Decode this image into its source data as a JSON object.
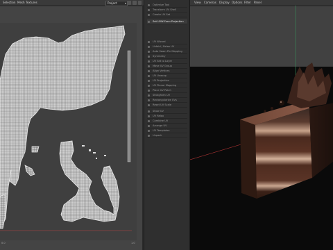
{
  "top_menu": [
    "Selection",
    "Mesh",
    "Textures"
  ],
  "uv_header": {
    "dropdown_value": "Project"
  },
  "uv_footer": {
    "left_value": "0.0",
    "right_value": "1.0"
  },
  "colors": {
    "wire": "#e2e2e2",
    "accent": "#2f6fb3",
    "green_axis": "#3a8f5a",
    "red_axis": "#a33"
  },
  "tools": {
    "items": [
      "Optimize Tool",
      "Transform UV Shell",
      "Create UV Set",
      "Set UVW From Projection",
      "UV Wizard",
      "Unfold / Relax UV",
      "Auto Seam Pin Mapping",
      "Symmetry",
      "UV Set to Layer",
      "Move UV Group",
      "Align Vertices",
      "UV Unwrap",
      "UV Projection",
      "UV Planar Mapping",
      "Place UV Patch",
      "Straighten UV",
      "Rectangularize UVs",
      "Reset UV Scale",
      "Show UV",
      "UV Relax",
      "Combine UV",
      "Arrange UV",
      "UV Templates",
      "Unpack"
    ]
  },
  "viewport_menu": [
    "View",
    "Cameras",
    "Display",
    "Options",
    "Filter",
    "Panel"
  ],
  "viewport_icons": [
    "globe-icon",
    "camera-icon",
    "light-icon",
    "grid-icon",
    "shading-icon",
    "eye-icon"
  ],
  "uv_header_icons": [
    "select-icon",
    "move-icon",
    "rotate-icon",
    "scale-icon"
  ]
}
